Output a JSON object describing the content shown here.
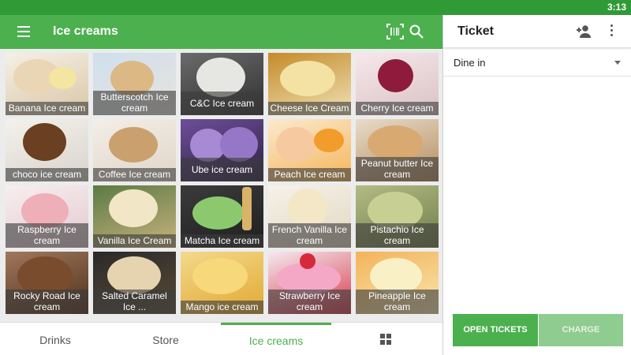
{
  "status_bar": {
    "time": "3:13"
  },
  "app_bar": {
    "title": "Ice creams",
    "icons": [
      "menu-icon",
      "barcode-icon",
      "search-icon"
    ]
  },
  "products": [
    {
      "label": "Banana Ice cream"
    },
    {
      "label": "Butterscotch Ice cream"
    },
    {
      "label": "C&C Ice cream"
    },
    {
      "label": "Cheese  Ice Cream"
    },
    {
      "label": "Cherry Ice cream"
    },
    {
      "label": "choco ice cream"
    },
    {
      "label": "Coffee Ice cream"
    },
    {
      "label": "Ube ice cream"
    },
    {
      "label": "Peach Ice cream"
    },
    {
      "label": "Peanut butter Ice cream"
    },
    {
      "label": "Raspberry Ice cream"
    },
    {
      "label": "Vanilla Ice Cream"
    },
    {
      "label": "Matcha Ice cream"
    },
    {
      "label": "French Vanilla Ice cream"
    },
    {
      "label": "Pistachio Ice cream"
    },
    {
      "label": "Rocky Road Ice cream"
    },
    {
      "label": "Salted Caramel Ice ..."
    },
    {
      "label": "Mango ice cream"
    },
    {
      "label": "Strawberry Ice cream"
    },
    {
      "label": "Pineapple Ice cream"
    }
  ],
  "bottom_nav": {
    "tabs": [
      "Drinks",
      "Store",
      "Ice creams"
    ],
    "active_tab": "Ice creams",
    "grid_icon": "grid-icon"
  },
  "ticket": {
    "title": "Ticket",
    "dining_option": "Dine in",
    "open_tickets_label": "OPEN TICKETS",
    "charge_label": "CHARGE"
  },
  "colors": {
    "primary": "#4cb04f",
    "status_bar": "#2f9a36",
    "charge_disabled": "#8fcc8f"
  }
}
